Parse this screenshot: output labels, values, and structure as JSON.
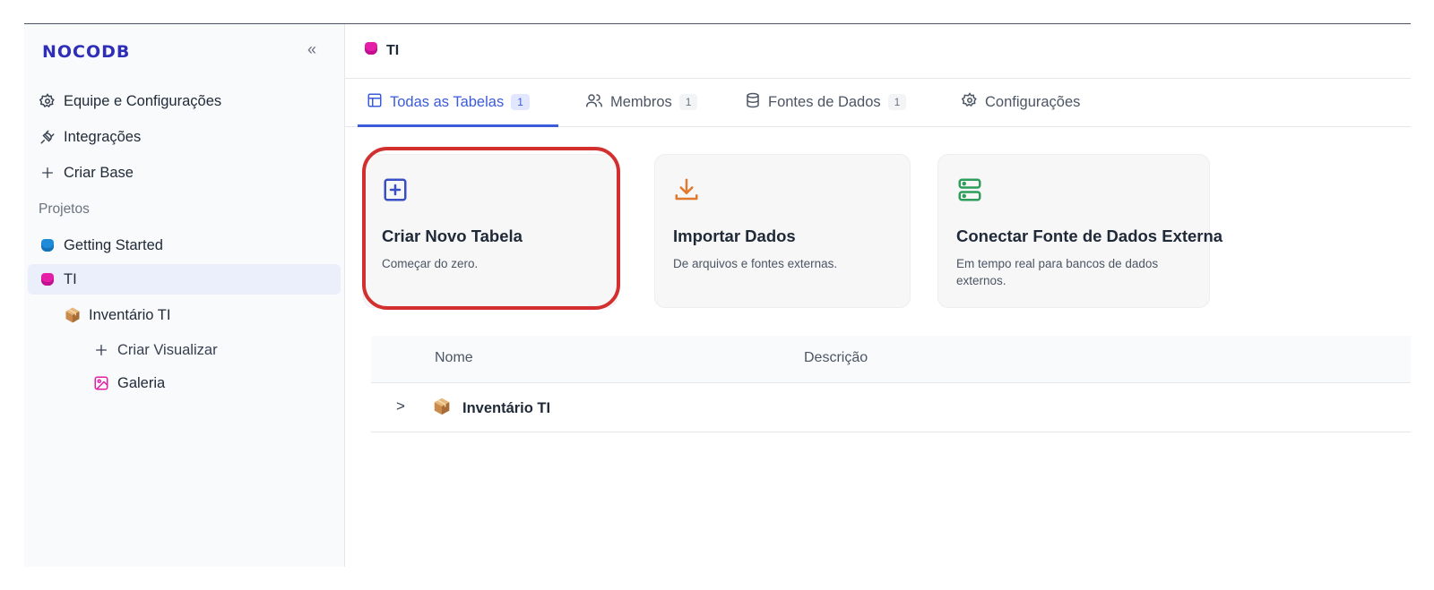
{
  "sidebar": {
    "brand": "NOCODB",
    "collapse": "«",
    "team_settings": "Equipe e Configurações",
    "integrations": "Integrações",
    "create_base": "Criar Base",
    "projects_label": "Projetos",
    "projects": [
      {
        "name": "Getting Started",
        "color": "#1f8ad8"
      },
      {
        "name": "TI",
        "color": "#e51ea8"
      }
    ],
    "table_name": "Inventário TI",
    "create_view": "Criar Visualizar",
    "gallery": "Galeria"
  },
  "header": {
    "title": "TI"
  },
  "tabs": [
    {
      "label": "Todas as Tabelas",
      "badge": "1"
    },
    {
      "label": "Membros",
      "badge": "1"
    },
    {
      "label": "Fontes de Dados",
      "badge": "1"
    },
    {
      "label": "Configurações"
    }
  ],
  "cards": [
    {
      "title": "Criar Novo Tabela",
      "subtitle": "Começar do zero.",
      "icon": "plus-square-icon",
      "color": "#3b4fc4"
    },
    {
      "title": "Importar Dados",
      "subtitle": "De arquivos e fontes externas.",
      "icon": "download-icon",
      "color": "#e0782d"
    },
    {
      "title": "Conectar Fonte de Dados Externa",
      "subtitle": "Em tempo real para bancos de dados externos.",
      "icon": "server-icon",
      "color": "#2f9e5b"
    }
  ],
  "table": {
    "columns": [
      "Nome",
      "Descrição"
    ],
    "rows": [
      {
        "name": "Inventário TI",
        "chevron": ">"
      }
    ]
  },
  "colors": {
    "accent": "#3b5bdb",
    "highlight": "#d32f2f",
    "project_ti": "#e51ea8"
  }
}
